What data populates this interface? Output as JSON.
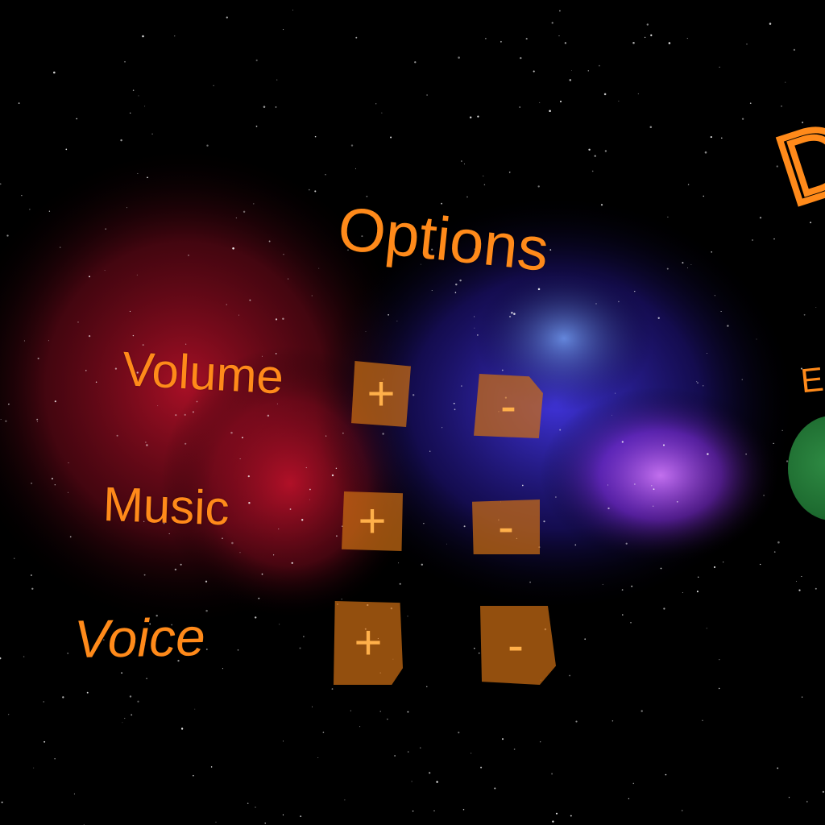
{
  "menu": {
    "title": "Options",
    "rows": [
      {
        "label": "Volume",
        "plus": "+",
        "minus": "-"
      },
      {
        "label": "Music",
        "plus": "+",
        "minus": "-"
      },
      {
        "label": "Voice",
        "plus": "+",
        "minus": "-"
      }
    ]
  },
  "side_panel": {
    "letter_top": "D",
    "letter_mid": "E"
  },
  "colors": {
    "text": "#ff8a1a",
    "button": "#cc6e14",
    "nebula_red": "#b3122a",
    "nebula_blue": "#3a2bd8",
    "nebula_violet": "#9b3bff",
    "orb": "#2e8a43"
  }
}
